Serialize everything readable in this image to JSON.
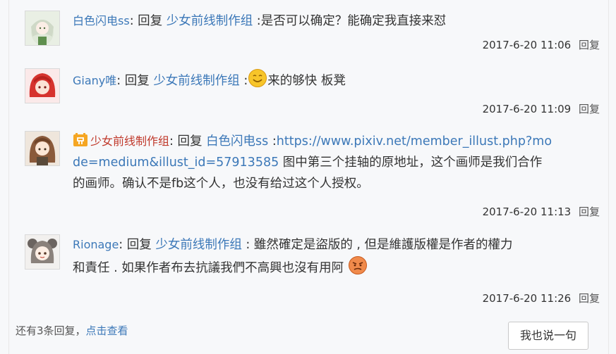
{
  "colors": {
    "link": "#3c78b8",
    "admin_name": "#c0392b",
    "background": "#f7f8fa"
  },
  "comments": [
    {
      "user": "白色闪电ss",
      "reply_word": "回复",
      "target": "少女前线制作组",
      "text": " :是否可以确定？能确定我直接来怼",
      "time": "2017-6-20 11:06",
      "reply_label": "回复",
      "avatar_icon": "green-haired-girl-avatar"
    },
    {
      "user": "Giany唯",
      "reply_word": "回复",
      "target": "少女前线制作组",
      "text_before": " :",
      "emoji_icon": "smiley-face-icon",
      "text": "来的够快 板凳",
      "time": "2017-6-20 11:09",
      "reply_label": "回复",
      "avatar_icon": "red-haired-girl-avatar"
    },
    {
      "user": "少女前线制作组",
      "badge_icon": "official-badge-icon",
      "reply_word": "回复",
      "target": "白色闪电ss",
      "text_before": " :",
      "link": "https://www.pixiv.net/member_illust.php?mode=medium&illust_id=57913585",
      "link_line1": "https://www.pixiv.net/member_illust.php?mo",
      "link_line2": "de=medium&illust_id=57913585",
      "text_line2": " 图中第三个挂轴的原地址，这个画师是我们合作",
      "text_line3": "的画师。确认不是fb这个人，也没有给过这个人授权。",
      "time": "2017-6-20 11:13",
      "reply_label": "回复",
      "avatar_icon": "brown-haired-girl-avatar"
    },
    {
      "user": "Rionage",
      "reply_word": "回复",
      "target": "少女前线制作组",
      "text_line1": " : 雖然確定是盜版的 , 但是維護版權是作者的權力",
      "text_line2": "和責任 . 如果作者布去抗議我們不高興也沒有用阿 ",
      "emoji_icon": "angry-face-icon",
      "time": "2017-6-20 11:26",
      "reply_label": "回复",
      "avatar_icon": "gray-haired-girl-avatar"
    }
  ],
  "footer": {
    "more_text": "还有3条回复，",
    "click_text": "点击查看",
    "say_button": "我也说一句"
  }
}
